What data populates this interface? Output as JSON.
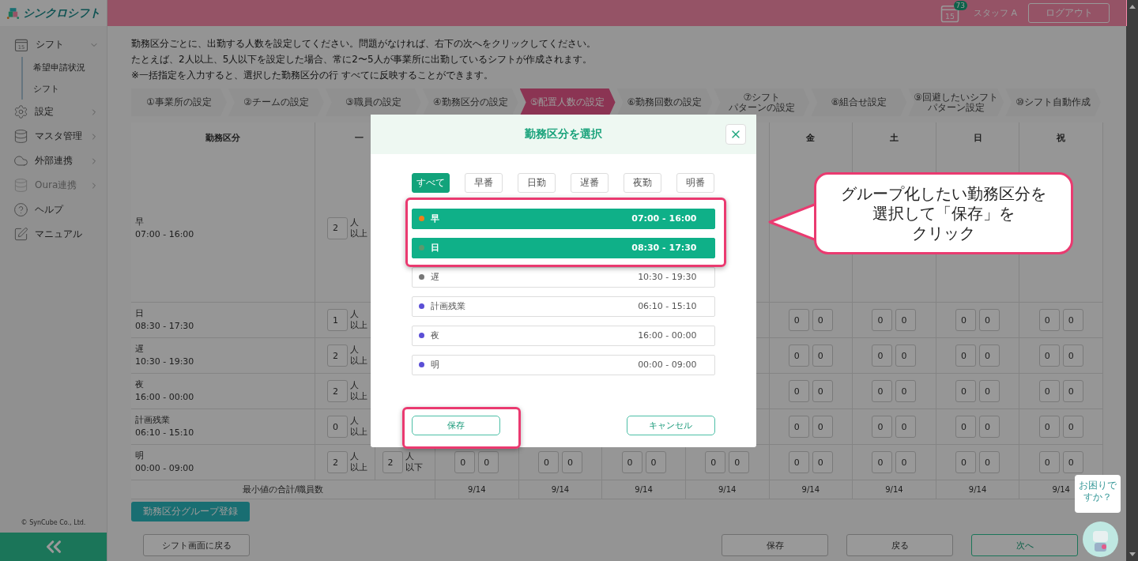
{
  "app": {
    "logo": "シンクロシフト",
    "copyright": "© SynCube Co., Ltd."
  },
  "header": {
    "calendar_day": "15",
    "notification_count": "73",
    "user": "スタッフ A",
    "logout": "ログアウト"
  },
  "sidebar": {
    "items": [
      {
        "label": "シフト",
        "icon_text": "15",
        "expandable": true,
        "expanded": true,
        "disabled": false,
        "children": [
          {
            "label": "希望申請状況"
          },
          {
            "label": "シフト"
          }
        ]
      },
      {
        "label": "設定",
        "expandable": true,
        "expanded": false,
        "disabled": false
      },
      {
        "label": "マスタ管理",
        "expandable": true,
        "expanded": false,
        "disabled": false
      },
      {
        "label": "外部連携",
        "expandable": true,
        "expanded": false,
        "disabled": false
      },
      {
        "label": "Oura連携",
        "expandable": true,
        "expanded": false,
        "disabled": true
      },
      {
        "label": "ヘルプ",
        "expandable": false,
        "disabled": false
      },
      {
        "label": "マニュアル",
        "expandable": false,
        "disabled": false
      }
    ]
  },
  "instructions": [
    "勤務区分ごとに、出勤する人数を設定してください。問題がなければ、右下の次へをクリックしてください。",
    "たとえば、2人以上、5人以下を設定した場合、常に2〜5人が事業所に出勤しているシフトが作成されます。",
    "※一括指定を入力すると、選択した勤務区分の行 すべてに反映することができます。"
  ],
  "steps": [
    {
      "lines": [
        "①事業所の設定"
      ],
      "selected": false
    },
    {
      "lines": [
        "②チームの設定"
      ],
      "selected": false
    },
    {
      "lines": [
        "③職員の設定"
      ],
      "selected": false
    },
    {
      "lines": [
        "④勤務区分の設定"
      ],
      "selected": false
    },
    {
      "lines": [
        "⑤配置人数の設定"
      ],
      "selected": true
    },
    {
      "lines": [
        "⑥勤務回数の設定"
      ],
      "selected": false
    },
    {
      "lines": [
        "⑦シフト",
        "パターンの設定"
      ],
      "selected": false
    },
    {
      "lines": [
        "⑧組合せ設定"
      ],
      "selected": false
    },
    {
      "lines": [
        "⑨回避したいシフト",
        "パターン設定"
      ],
      "selected": false
    },
    {
      "lines": [
        "⑩シフト自動作成"
      ],
      "selected": false
    }
  ],
  "table": {
    "shift_header": "勤務区分",
    "bulk_header": "一",
    "day_headers": [
      "金",
      "土",
      "日",
      "祝"
    ],
    "rows": [
      {
        "name": "早",
        "time": "07:00 - 16:00",
        "min": {
          "value": "2",
          "unit": "人",
          "bound": "以上"
        }
      },
      {
        "name": "日",
        "time": "08:30 - 17:30",
        "min": {
          "value": "1",
          "unit": "人",
          "bound": "以上"
        },
        "days": [
          [
            "0",
            "0"
          ],
          [
            "0",
            "0"
          ],
          [
            "0",
            "0"
          ],
          [
            "0",
            "0"
          ]
        ]
      },
      {
        "name": "遅",
        "time": "10:30 - 19:30",
        "min": {
          "value": "2",
          "unit": "人",
          "bound": "以上"
        },
        "days": [
          [
            "0",
            "0"
          ],
          [
            "0",
            "0"
          ],
          [
            "0",
            "0"
          ],
          [
            "0",
            "0"
          ]
        ]
      },
      {
        "name": "夜",
        "time": "16:00 - 00:00",
        "min": {
          "value": "2",
          "unit": "人",
          "bound": "以上"
        },
        "days": [
          [
            "0",
            "0"
          ],
          [
            "0",
            "0"
          ],
          [
            "0",
            "0"
          ],
          [
            "0",
            "0"
          ]
        ]
      },
      {
        "name": "計画残業",
        "time": "06:10 - 15:10",
        "min": {
          "value": "0",
          "unit": "人",
          "bound": "以上"
        },
        "days": [
          [
            "0",
            "0"
          ],
          [
            "0",
            "0"
          ],
          [
            "0",
            "0"
          ],
          [
            "0",
            "0"
          ]
        ]
      },
      {
        "name": "明",
        "time": "00:00 - 09:00",
        "min": {
          "value": "2",
          "unit": "人",
          "bound": "以上"
        },
        "max": {
          "value": "2",
          "unit": "人",
          "bound": "以下"
        },
        "days": [
          [
            "0",
            "0"
          ],
          [
            "0",
            "0"
          ],
          [
            "0",
            "0"
          ],
          [
            "0",
            "0"
          ],
          [
            "0",
            "0"
          ],
          [
            "0",
            "0"
          ],
          [
            "0",
            "0"
          ],
          [
            "0",
            "0"
          ]
        ]
      }
    ],
    "total": {
      "label": "最小値の合計/職員数",
      "values": [
        "9/14",
        "9/14",
        "9/14",
        "9/14",
        "9/14",
        "9/14",
        "9/14",
        "9/14"
      ]
    }
  },
  "group_register_button": "勤務区分グループ登録",
  "footer": {
    "back_to_shift": "シフト画面に戻る",
    "save": "保存",
    "back": "戻る",
    "next": "次へ"
  },
  "help_bubble": "お困りですか？",
  "modal": {
    "title": "勤務区分を選択",
    "filters": [
      {
        "label": "すべて",
        "selected": true
      },
      {
        "label": "早番",
        "selected": false
      },
      {
        "label": "日勤",
        "selected": false
      },
      {
        "label": "遅番",
        "selected": false
      },
      {
        "label": "夜勤",
        "selected": false
      },
      {
        "label": "明番",
        "selected": false
      }
    ],
    "items": [
      {
        "name": "早",
        "time": "07:00 - 16:00",
        "color": "#f07f1a",
        "selected": true
      },
      {
        "name": "日",
        "time": "08:30 - 17:30",
        "color": "#5a9a6e",
        "selected": true
      },
      {
        "name": "遅",
        "time": "10:30 - 19:30",
        "color": "#777777",
        "selected": false
      },
      {
        "name": "計画残業",
        "time": "06:10 - 15:10",
        "color": "#5b4fd6",
        "selected": false
      },
      {
        "name": "夜",
        "time": "16:00 - 00:00",
        "color": "#5b4fd6",
        "selected": false
      },
      {
        "name": "明",
        "time": "00:00 - 09:00",
        "color": "#5b4fd6",
        "selected": false
      }
    ],
    "save": "保存",
    "cancel": "キャンセル"
  },
  "callout": [
    "グループ化したい勤務区分を",
    "選択して「保存」を",
    "クリック"
  ]
}
